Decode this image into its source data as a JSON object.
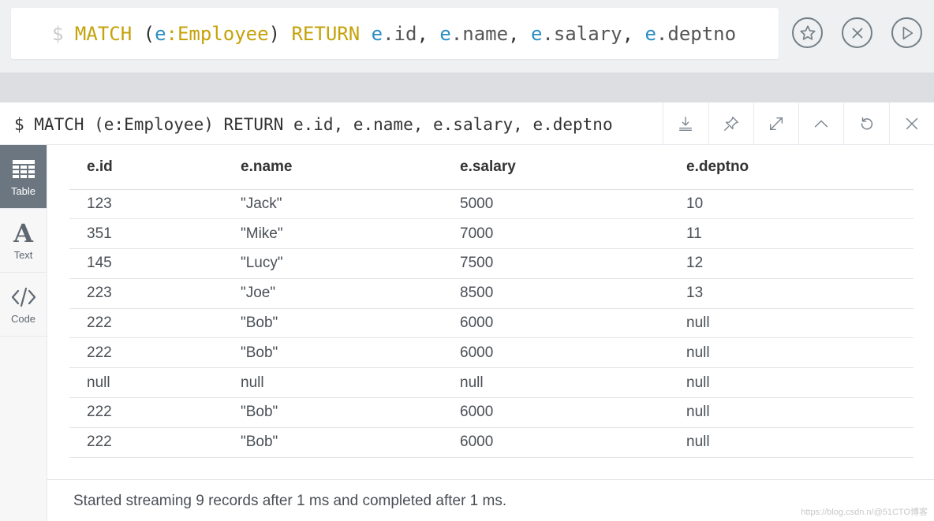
{
  "editor": {
    "tokens": [
      {
        "text": "$ ",
        "cls": "tok-prompt"
      },
      {
        "text": "MATCH",
        "cls": "tok-kw"
      },
      {
        "text": " (",
        "cls": "tok-punc"
      },
      {
        "text": "e",
        "cls": "tok-var"
      },
      {
        "text": ":Employee",
        "cls": "tok-label"
      },
      {
        "text": ") ",
        "cls": "tok-punc"
      },
      {
        "text": "RETURN",
        "cls": "tok-kw"
      },
      {
        "text": " ",
        "cls": "tok-punc"
      },
      {
        "text": "e",
        "cls": "tok-var"
      },
      {
        "text": ".id",
        "cls": "tok-prop"
      },
      {
        "text": ", ",
        "cls": "tok-punc"
      },
      {
        "text": "e",
        "cls": "tok-var"
      },
      {
        "text": ".name",
        "cls": "tok-prop"
      },
      {
        "text": ", ",
        "cls": "tok-punc"
      },
      {
        "text": "e",
        "cls": "tok-var"
      },
      {
        "text": ".salary",
        "cls": "tok-prop"
      },
      {
        "text": ", ",
        "cls": "tok-punc"
      },
      {
        "text": "e",
        "cls": "tok-var"
      },
      {
        "text": ".deptno",
        "cls": "tok-prop"
      }
    ],
    "buttons": [
      {
        "name": "favorite-button",
        "icon": "star-icon"
      },
      {
        "name": "clear-button",
        "icon": "close-circle-icon"
      },
      {
        "name": "run-button",
        "icon": "play-icon"
      }
    ]
  },
  "frame": {
    "title": "$ MATCH (e:Employee) RETURN e.id, e.name, e.salary, e.deptno",
    "actions": [
      {
        "name": "download-button",
        "icon": "download-icon"
      },
      {
        "name": "pin-button",
        "icon": "pin-icon"
      },
      {
        "name": "fullscreen-button",
        "icon": "expand-icon"
      },
      {
        "name": "collapse-button",
        "icon": "chevron-up-icon"
      },
      {
        "name": "rerun-button",
        "icon": "refresh-icon"
      },
      {
        "name": "close-frame-button",
        "icon": "close-icon"
      }
    ]
  },
  "views": [
    {
      "label": "Table",
      "icon": "table-icon",
      "active": true
    },
    {
      "label": "Text",
      "icon": "text-icon",
      "active": false
    },
    {
      "label": "Code",
      "icon": "code-icon",
      "active": false
    }
  ],
  "table": {
    "headers": [
      "e.id",
      "e.name",
      "e.salary",
      "e.deptno"
    ],
    "rows": [
      [
        "123",
        "\"Jack\"",
        "5000",
        "10"
      ],
      [
        "351",
        "\"Mike\"",
        "7000",
        "11"
      ],
      [
        "145",
        "\"Lucy\"",
        "7500",
        "12"
      ],
      [
        "223",
        "\"Joe\"",
        "8500",
        "13"
      ],
      [
        "222",
        "\"Bob\"",
        "6000",
        "null"
      ],
      [
        "222",
        "\"Bob\"",
        "6000",
        "null"
      ],
      [
        "null",
        "null",
        "null",
        "null"
      ],
      [
        "222",
        "\"Bob\"",
        "6000",
        "null"
      ],
      [
        "222",
        "\"Bob\"",
        "6000",
        "null"
      ]
    ]
  },
  "status": {
    "text": "Started streaming 9 records after 1 ms and completed after 1 ms."
  },
  "watermark": "https://blog.csdn.n/@51CTO博客",
  "colors": {
    "keyword": "#c5a20a",
    "variable": "#2a8ec2",
    "active_tab": "#6c7680"
  }
}
